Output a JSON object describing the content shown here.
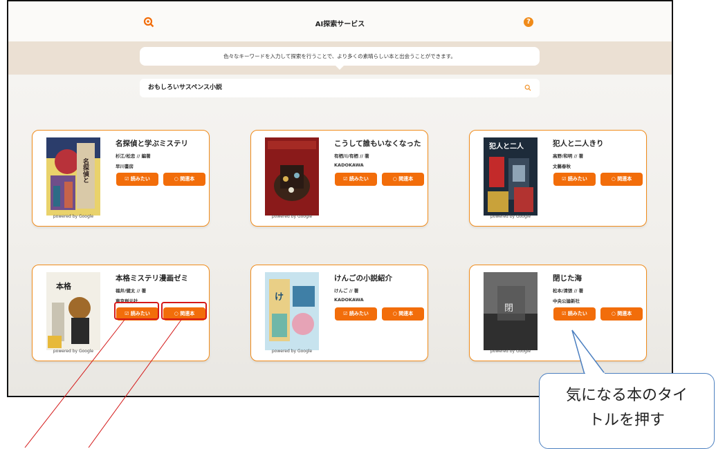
{
  "header": {
    "title": "AI探索サービス",
    "help_icon": "?"
  },
  "intro": {
    "message": "色々なキーワードを入力して探索を行うことで、より多くの素晴らしい本と出会うことができます。"
  },
  "search": {
    "query": "おもしろいサスペンス小説",
    "icon": "search-icon"
  },
  "buttons": {
    "want": "読みたい",
    "related": "関連本"
  },
  "powered_by": "powered by Google",
  "books": [
    {
      "title": "名探偵と学ぶミステリ",
      "author": "杉江/松恋 // 編著",
      "publisher": "早川書房",
      "cover_color": "#2b3d6b"
    },
    {
      "title": "こうして誰もいなくなった",
      "author": "有栖川/有栖 // 著",
      "publisher": "KADOKAWA",
      "cover_color": "#8a1a1a"
    },
    {
      "title": "犯人と二人きり",
      "author": "高野/和明 // 著",
      "publisher": "文藝春秋",
      "cover_color": "#1d2b3a"
    },
    {
      "title": "本格ミステリ漫画ゼミ",
      "author": "福井/健太 // 著",
      "publisher": "東京創元社",
      "cover_color": "#f2efe6"
    },
    {
      "title": "けんごの小説紹介",
      "author": "けんご // 著",
      "publisher": "KADOKAWA",
      "cover_color": "#c7e3ee"
    },
    {
      "title": "閉じた海",
      "author": "松本/清張 // 著",
      "publisher": "中央公論新社",
      "cover_color": "#4a4a4a"
    }
  ],
  "annotation": {
    "callout_line1": "気になる本のタイ",
    "callout_line2": "トルを押す"
  }
}
